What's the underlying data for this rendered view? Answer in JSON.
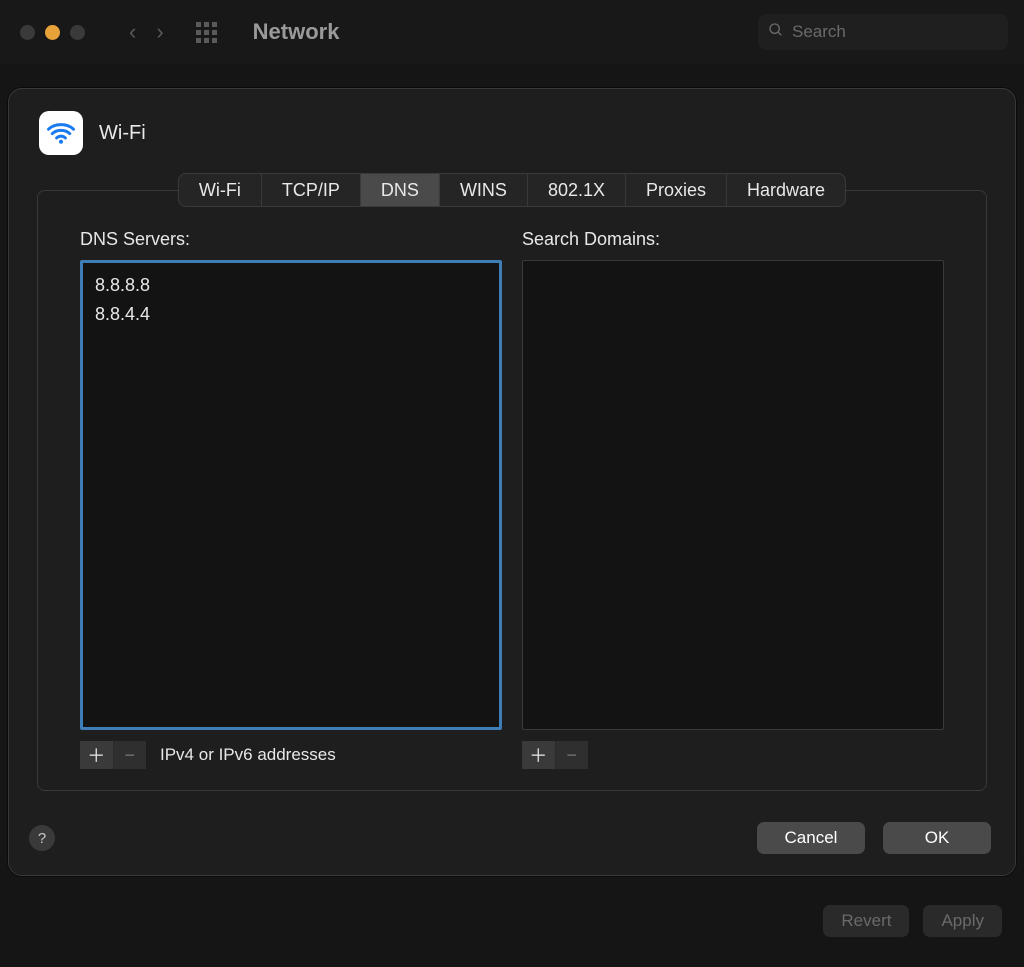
{
  "window": {
    "title": "Network",
    "search_placeholder": "Search"
  },
  "sheet": {
    "interface_name": "Wi-Fi",
    "tabs": [
      "Wi-Fi",
      "TCP/IP",
      "DNS",
      "WINS",
      "802.1X",
      "Proxies",
      "Hardware"
    ],
    "active_tab_index": 2,
    "dns": {
      "label": "DNS Servers:",
      "servers": [
        "8.8.8.8",
        "8.8.4.4"
      ],
      "hint": "IPv4 or IPv6 addresses"
    },
    "search_domains": {
      "label": "Search Domains:",
      "domains": []
    },
    "help_label": "?",
    "cancel_label": "Cancel",
    "ok_label": "OK"
  },
  "background_buttons": {
    "revert_label": "Revert",
    "apply_label": "Apply"
  },
  "glyphs": {
    "plus": "＋",
    "minus": "−",
    "chev_left": "‹",
    "chev_right": "›"
  }
}
